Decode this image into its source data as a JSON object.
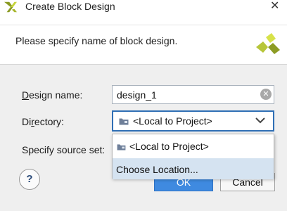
{
  "window": {
    "title": "Create Block Design",
    "close_glyph": "✕",
    "icon": "vivado-logo-icon"
  },
  "header": {
    "prompt": "Please specify name of block design.",
    "logo_icon": "vivado-logo-icon"
  },
  "form": {
    "design_name": {
      "mnemonic": "D",
      "label_rest": "esign name:",
      "value": "design_1",
      "clear_glyph": "✕"
    },
    "directory": {
      "label_pre": "Di",
      "mnemonic": "r",
      "label_post": "ectory:",
      "selected": "<Local to Project>",
      "icon": "folder-icon",
      "chevron_icon": "chevron-down-icon"
    },
    "source_set": {
      "label": "Specify source set:"
    }
  },
  "dropdown": {
    "options": [
      {
        "label": "<Local to Project>",
        "icon": "folder-icon"
      },
      {
        "label": "Choose Location...",
        "highlighted": true
      }
    ]
  },
  "buttons": {
    "help": "?",
    "ok": "OK",
    "cancel": "Cancel"
  },
  "colors": {
    "accent": "#3f8ae0",
    "focus_border": "#2f6fb5",
    "highlight": "#d5e3f1",
    "logo_dark": "#7a8a1e",
    "logo_light": "#c5d43a"
  }
}
